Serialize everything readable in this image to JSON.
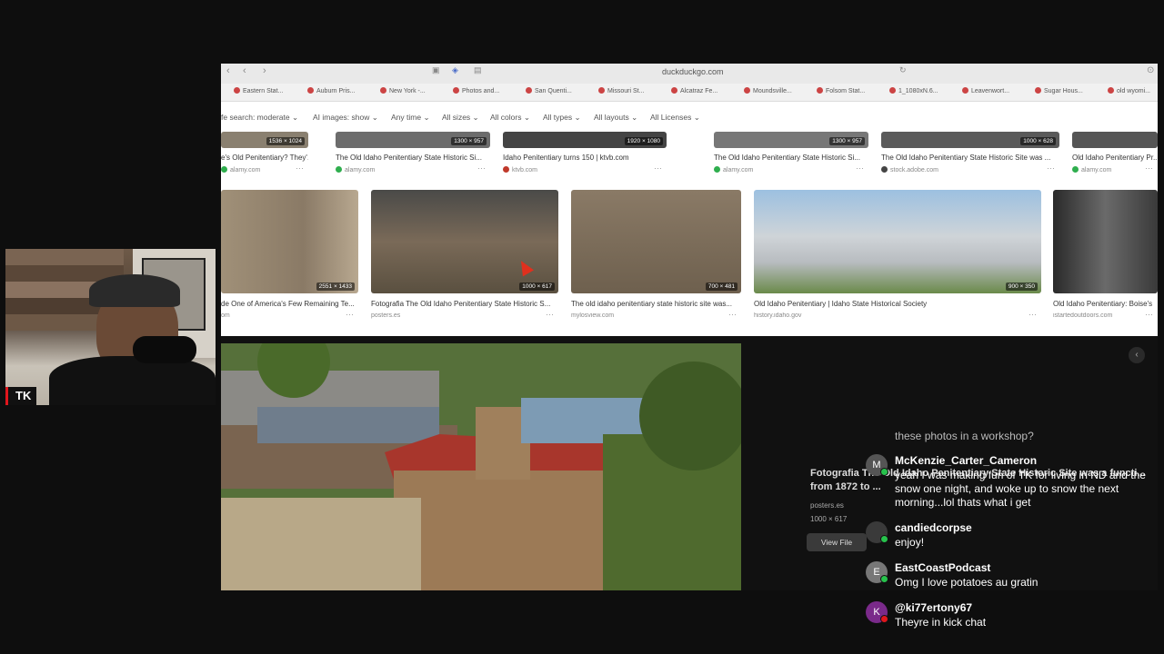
{
  "webcam": {
    "label": "TK"
  },
  "browser": {
    "url": "duckduckgo.com",
    "bookmarks": [
      "Eastern Stat...",
      "Auburn Pris...",
      "New York -...",
      "Photos and...",
      "San Quenti...",
      "Missouri St...",
      "Alcatraz Fe...",
      "Moundsville...",
      "Folsom Stat...",
      "1_1080xN.6...",
      "Leavenwort...",
      "Sugar Hous...",
      "old wyomi..."
    ],
    "filters": [
      "fe search: moderate",
      "AI images: show",
      "Any time",
      "All sizes",
      "All colors",
      "All types",
      "All layouts",
      "All Licenses"
    ]
  },
  "row1": [
    {
      "dims": "1536 × 1024",
      "title": "e's Old Penitentiary? They'...",
      "source": "alamy.com",
      "fav": "#2fae4e"
    },
    {
      "dims": "1300 × 957",
      "title": "The Old Idaho Penitentiary State Historic Si...",
      "source": "alamy.com",
      "fav": "#2fae4e"
    },
    {
      "dims": "1920 × 1080",
      "title": "Idaho Penitentiary turns 150 | ktvb.com",
      "source": "ktvb.com",
      "fav": "#c0392b"
    },
    {
      "dims": "1300 × 957",
      "title": "The Old Idaho Penitentiary State Historic Si...",
      "source": "alamy.com",
      "fav": "#2fae4e"
    },
    {
      "dims": "1000 × 628",
      "title": "The Old Idaho Penitentiary State Historic Site was ...",
      "source": "stock.adobe.com",
      "fav": "#444"
    },
    {
      "dims": "",
      "title": "Old Idaho Penitentiary Pr...",
      "source": "alamy.com",
      "fav": "#2fae4e"
    }
  ],
  "row2": [
    {
      "dims": "2551 × 1433",
      "title": "de One of America's Few Remaining Te...",
      "source": "om"
    },
    {
      "dims": "1000 × 617",
      "title": "Fotografia The Old Idaho Penitentiary State Historic S...",
      "source": "posters.es"
    },
    {
      "dims": "700 × 481",
      "title": "The old idaho penitentiary state historic site was...",
      "source": "mylosview.com"
    },
    {
      "dims": "900 × 350",
      "title": "Old Idaho Penitentiary | Idaho State Historical Society",
      "source": "history.idaho.gov"
    },
    {
      "dims": "",
      "title": "Old Idaho Penitentiary: Boise's",
      "source": "istartedoutdoors.com"
    }
  ],
  "preview": {
    "title": "Fotografia The Old Idaho Penitentiary State Historic Site was a functi... from 1872 to ...",
    "source": "posters.es",
    "dims": "1000 × 617",
    "button": "View File"
  },
  "chat": {
    "previous_tail": "these photos in a workshop?",
    "messages": [
      {
        "avatar": "M",
        "user": "McKenzie_Carter_Cameron",
        "text": "yeah I was making fun of TK for living in ND and the snow one night, and woke up to snow the next morning...lol thats what i get",
        "avatar_color": "#555",
        "badge_color": "#27c24c"
      },
      {
        "avatar": "",
        "user": "candiedcorpse",
        "text": "enjoy!",
        "avatar_color": "#3a3a3a",
        "badge_color": "#27c24c"
      },
      {
        "avatar": "E",
        "user": "EastCoastPodcast",
        "text": "Omg I love potatoes au gratin",
        "avatar_color": "#777",
        "badge_color": "#27c24c"
      },
      {
        "avatar": "K",
        "user": "@ki77ertony67",
        "text": "Theyre in kick chat",
        "avatar_color": "#7a2a8a",
        "badge_color": "#e0161c"
      }
    ]
  }
}
